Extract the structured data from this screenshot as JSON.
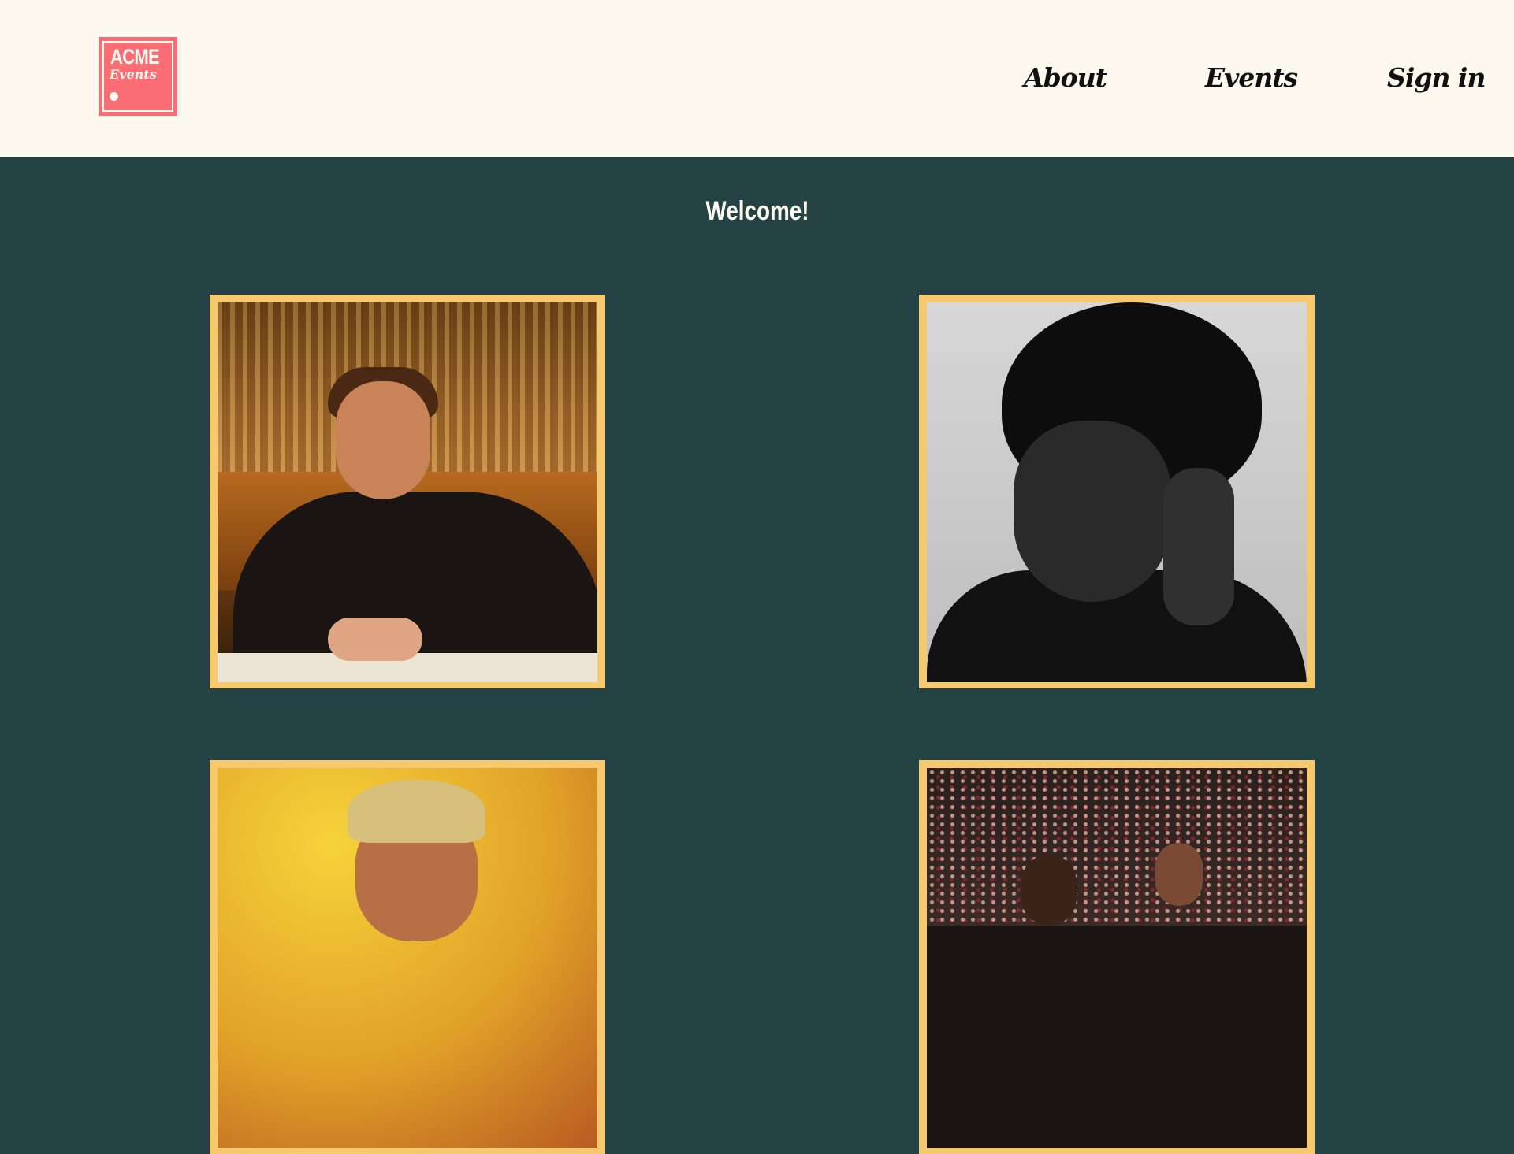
{
  "header": {
    "logo": {
      "line1": "ACME",
      "line2": "Events"
    },
    "nav": {
      "about": "About",
      "events": "Events",
      "sign_in": "Sign in"
    }
  },
  "main": {
    "heading": "Welcome!"
  },
  "colors": {
    "header_bg": "#fdf9ee",
    "page_bg": "#254344",
    "logo_bg": "#fb6d75",
    "card_frame": "#f7c96f",
    "heading_text": "#fdf9ee",
    "nav_text": "#111111"
  }
}
